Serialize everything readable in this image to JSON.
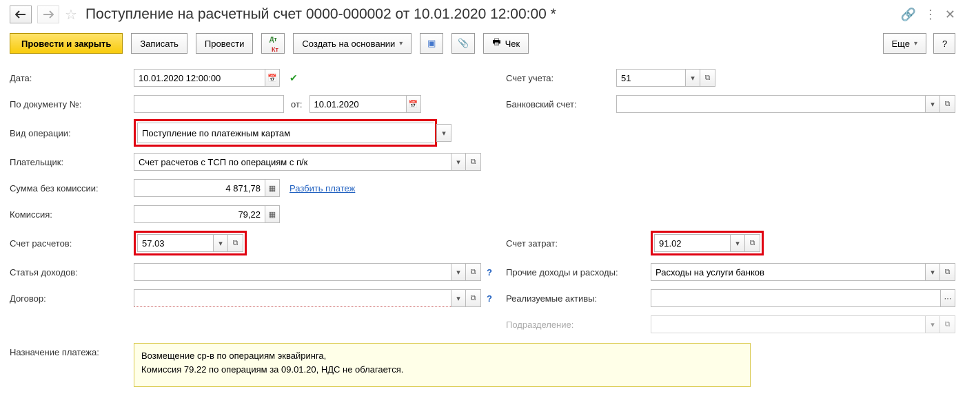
{
  "header": {
    "title": "Поступление на расчетный счет 0000-000002 от 10.01.2020 12:00:00 *"
  },
  "toolbar": {
    "postAndClose": "Провести и закрыть",
    "save": "Записать",
    "post": "Провести",
    "createBased": "Создать на основании",
    "check": "Чек",
    "more": "Еще",
    "help": "?"
  },
  "labels": {
    "date": "Дата:",
    "docNo": "По документу №:",
    "from": "от:",
    "opType": "Вид операции:",
    "payer": "Плательщик:",
    "sumNoFee": "Сумма без комиссии:",
    "fee": "Комиссия:",
    "settleAcc": "Счет расчетов:",
    "incomeItem": "Статья доходов:",
    "contract": "Договор:",
    "purpose": "Назначение платежа:",
    "glAcc": "Счет учета:",
    "bankAcc": "Банковский счет:",
    "costAcc": "Счет затрат:",
    "otherIE": "Прочие доходы и расходы:",
    "assets": "Реализуемые активы:",
    "dept": "Подразделение:",
    "split": "Разбить платеж"
  },
  "values": {
    "date": "10.01.2020 12:00:00",
    "docNo": "",
    "from": "10.01.2020",
    "opType": "Поступление по платежным картам",
    "payer": "Счет расчетов с ТСП по операциям с п/к",
    "sumNoFee": "4 871,78",
    "fee": "79,22",
    "settleAcc": "57.03",
    "incomeItem": "",
    "contract": "",
    "glAcc": "51",
    "bankAcc": "",
    "costAcc": "91.02",
    "otherIE": "Расходы на услуги банков",
    "assets": "",
    "dept": "",
    "purpose": "Возмещение ср-в по операциям эквайринга,\nКомиссия 79.22 по операциям за 09.01.20, НДС не облагается."
  }
}
